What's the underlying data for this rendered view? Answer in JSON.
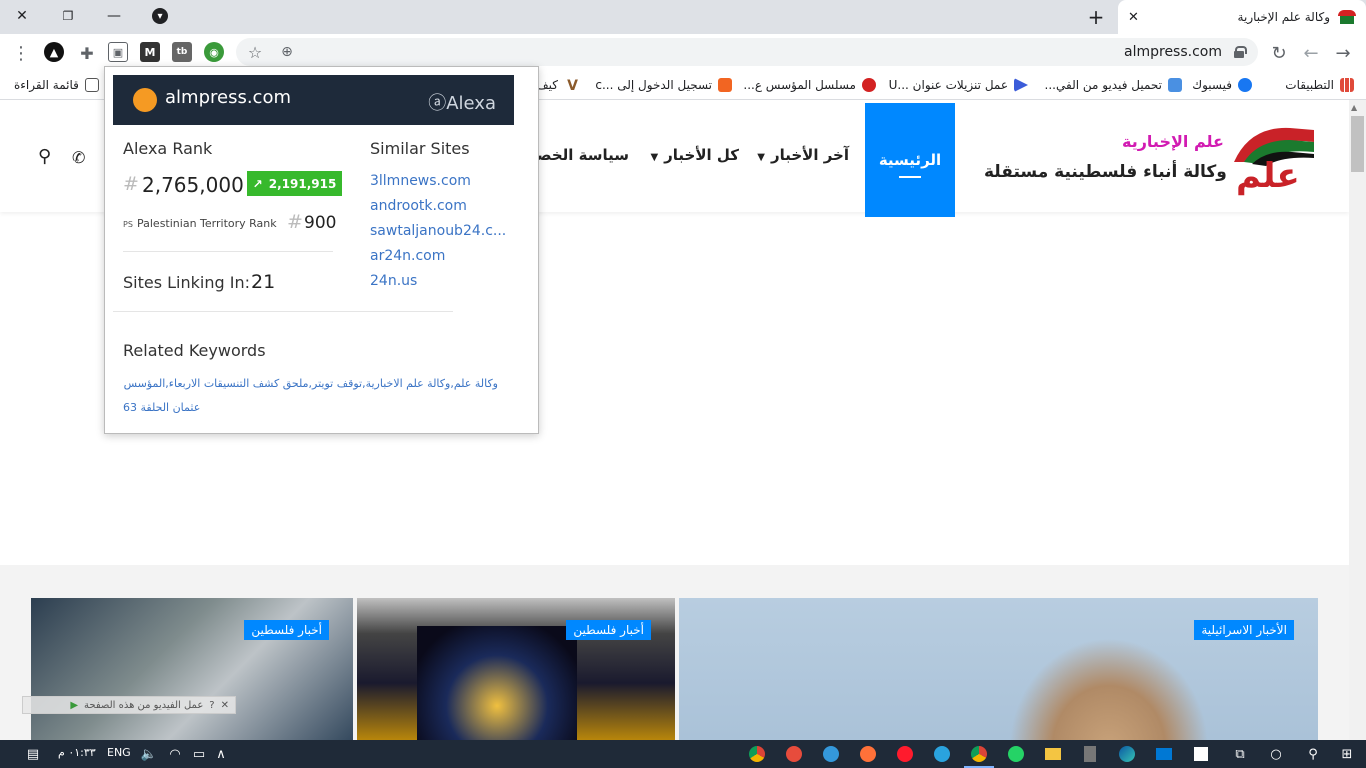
{
  "browser": {
    "tab_title": "وكالة علم الإخبارية",
    "tab_close": "✕",
    "new_tab": "+",
    "window_controls": {
      "close": "✕",
      "restore": "❐",
      "minimize": "—",
      "menu": "▾"
    },
    "url": "almpress.com",
    "toolbar_icons": [
      "more-icon",
      "alexa-icon",
      "extensions-icon",
      "cookie-icon",
      "m-icon",
      "tb-icon",
      "globe-icon",
      "star-icon",
      "zoom-icon",
      "reload-icon",
      "back-icon",
      "forward-icon"
    ]
  },
  "bookmarks": [
    {
      "label": "التطبيقات",
      "color": "#e04a3a"
    },
    {
      "label": "فيسبوك",
      "color": "#1877f2"
    },
    {
      "label": "تحميل فيديو من الفي...",
      "color": "#4a90e2"
    },
    {
      "label": "عمل تنزيلات عنوان ...U",
      "color": "#3b5cd9"
    },
    {
      "label": "مسلسل المؤسس ع...",
      "color": "#d32222"
    },
    {
      "label": "تسجيل الدخول إلى ...c",
      "color": "#f26522"
    },
    {
      "label": "كيف",
      "color": "#8b5a2b"
    },
    {
      "label": "قائمة القراءة",
      "color": "#555555"
    }
  ],
  "site": {
    "logo_text": "علم",
    "tagline1": "علم الإخبارية",
    "tagline2": "وكالة أنباء فلسطينية مستقلة",
    "nav": {
      "home": "الرئيسية",
      "latest": "آخر الأخبار",
      "all": "كل الأخبار",
      "privacy": "سياسة الخصو"
    },
    "cards": [
      {
        "badge": "أخبار فلسطين"
      },
      {
        "badge": "أخبار فلسطين"
      },
      {
        "badge": "الأخبار الاسرائيلية"
      }
    ],
    "float_bar": "عمل الفيديو من هذه الصفحة"
  },
  "alexa": {
    "domain": "almpress.com",
    "brand": "Alexa",
    "brand_mark": "ⓐ",
    "rank_label": "Alexa Rank",
    "rank_hash": "#",
    "rank_value": "2,765,000",
    "rank_delta": "2,191,915",
    "country_code": "PS",
    "country_name": "Palestinian Territory Rank",
    "country_rank": "900",
    "linking_label": "Sites Linking In:",
    "linking_value": "21",
    "similar_label": "Similar Sites",
    "similar_sites": [
      "3llmnews.com",
      "androotk.com",
      "sawtaljanoub24.c...",
      "ar24n.com",
      "24n.us"
    ],
    "keywords_label": "Related Keywords",
    "keywords_line1": "وكالة علم,وكالة علم الاخبارية,توقف تويتر,ملحق كشف التنسيقات الاربعاء,المؤسس",
    "keywords_line2": "عثمان الحلقة 63"
  },
  "taskbar": {
    "clock": "٠١:٣٣ م",
    "lang": "ENG"
  },
  "colors": {
    "accent": "#0088ff",
    "alexa_head": "#1e2a3a",
    "alexa_green": "#37b92c",
    "link": "#3b74c5"
  }
}
